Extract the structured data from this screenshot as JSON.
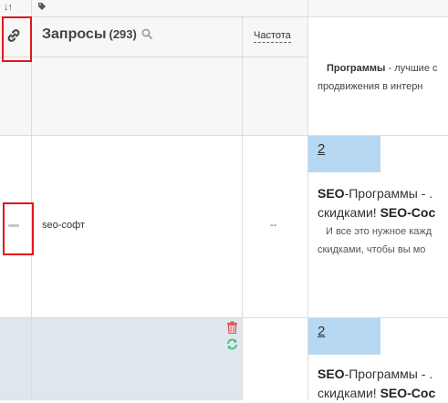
{
  "header": {
    "queries_title": "Запросы",
    "queries_count": "(293)",
    "frequency_label": "Частота"
  },
  "icons": {
    "sort": "sort-icon",
    "tag": "tag-icon",
    "link": "link-icon",
    "search": "search-icon",
    "minus": "minus-icon",
    "trash": "trash-icon",
    "refresh": "refresh-icon"
  },
  "colors": {
    "highlight_border": "#e0181b",
    "position_badge": "#b6d8f2",
    "selected_row": "#dfe6ec",
    "trash": "#e0534d",
    "refresh": "#3fbf7a"
  },
  "rows": [
    {
      "snippet_line1_bold": "Программы",
      "snippet_line1_rest": " - лучшие с",
      "snippet_line2": "продвижения в интерн"
    },
    {
      "query": "seo-софт",
      "frequency": "--",
      "position": "2",
      "title_line1_bold": "SEO",
      "title_line1_rest": "-Программы - .",
      "title_line2_rest": "скидками! ",
      "title_line2_bold": "SEO-Coc",
      "desc_line1": "И все это нужное кажд",
      "desc_line2": "скидками, чтобы вы мо"
    },
    {
      "position": "2",
      "title_line1_bold": "SEO",
      "title_line1_rest": "-Программы - .",
      "title_line2_rest": "скидками! ",
      "title_line2_bold": "SEO-Coc"
    }
  ]
}
